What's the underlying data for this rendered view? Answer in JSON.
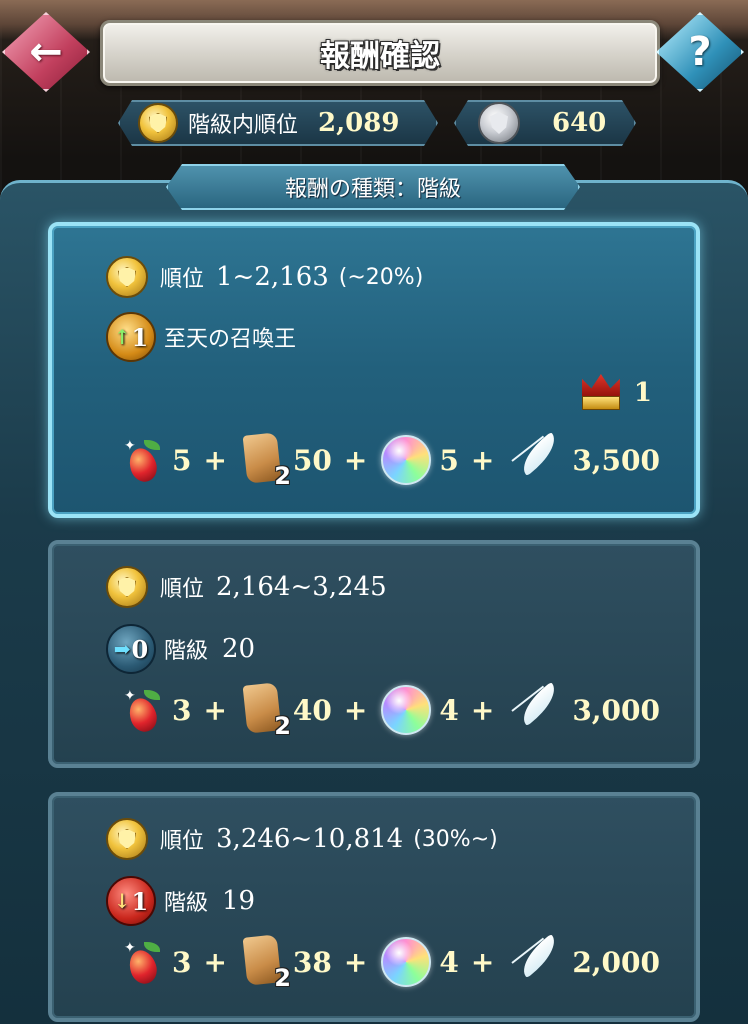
{
  "header": {
    "title": "報酬確認",
    "back_icon": "←",
    "help_icon": "?"
  },
  "stats": {
    "rank_label": "階級内順位",
    "rank_value": "2,089",
    "score_value": "640"
  },
  "reward_type": "報酬の種類：階級",
  "cards": [
    {
      "active": true,
      "rank_label": "順位",
      "rank_range": "1~2,163",
      "rank_pct": "(~20%)",
      "tier_change": "1",
      "tier_direction": "up",
      "tier_label": "至天の召喚王",
      "tier_num": "",
      "crown_count": "1",
      "rewards": {
        "fruit": "5",
        "scroll_count": "2",
        "scroll": "50",
        "orb": "5",
        "feather": "3,500"
      }
    },
    {
      "active": false,
      "rank_label": "順位",
      "rank_range": "2,164~3,245",
      "rank_pct": "",
      "tier_change": "0",
      "tier_direction": "stay",
      "tier_label": "階級",
      "tier_num": "20",
      "rewards": {
        "fruit": "3",
        "scroll_count": "2",
        "scroll": "40",
        "orb": "4",
        "feather": "3,000"
      }
    },
    {
      "active": false,
      "rank_label": "順位",
      "rank_range": "3,246~10,814",
      "rank_pct": "(30%~)",
      "tier_change": "1",
      "tier_direction": "down",
      "tier_label": "階級",
      "tier_num": "19",
      "rewards": {
        "fruit": "3",
        "scroll_count": "2",
        "scroll": "38",
        "orb": "4",
        "feather": "2,000"
      }
    }
  ],
  "plus": "+"
}
